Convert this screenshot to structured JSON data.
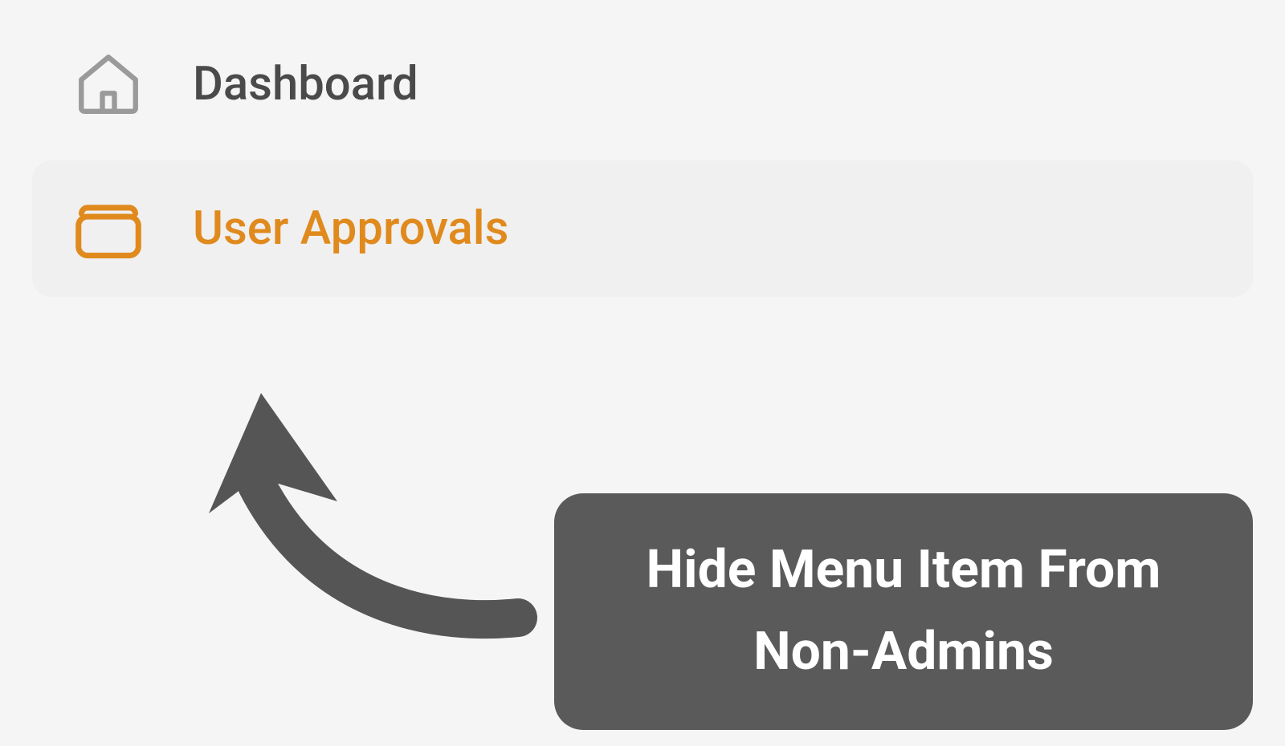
{
  "menu": {
    "items": [
      {
        "label": "Dashboard",
        "icon": "home-icon",
        "active": false
      },
      {
        "label": "User Approvals",
        "icon": "folder-icon",
        "active": true
      }
    ]
  },
  "callout": {
    "text": "Hide Menu Item From Non-Admins"
  },
  "colors": {
    "accent": "#e08a1e",
    "text_normal": "#4a4a4a",
    "icon_normal": "#9a9a9a",
    "callout_bg": "#5a5a5a",
    "callout_text": "#ffffff",
    "active_bg": "#f0f0f0"
  }
}
